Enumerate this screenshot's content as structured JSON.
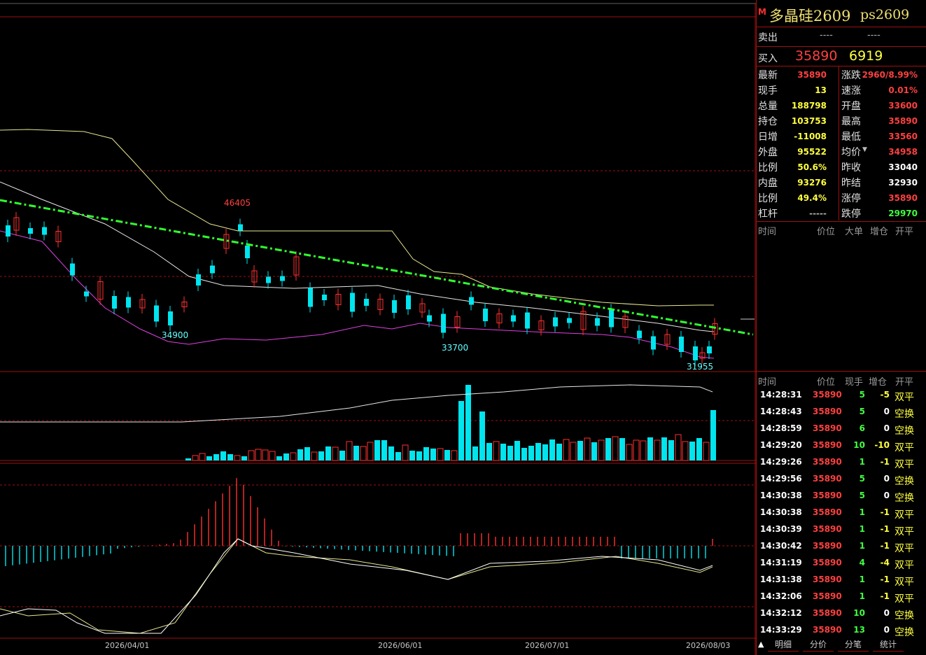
{
  "title": {
    "badge": "M",
    "name": "多晶硅2609",
    "code": "ps2609"
  },
  "sell": {
    "label": "卖出",
    "price": "----",
    "volume": "----"
  },
  "buy": {
    "label": "买入",
    "price": "35890",
    "volume": "6919"
  },
  "stats_left": [
    {
      "label": "最新",
      "value": "35890"
    },
    {
      "label": "现手",
      "value": "13"
    },
    {
      "label": "总量",
      "value": "188798"
    },
    {
      "label": "持仓",
      "value": "103753"
    },
    {
      "label": "日增",
      "value": "-11008"
    },
    {
      "label": "外盘",
      "value": "95522"
    },
    {
      "label": "比例",
      "value": "50.6%"
    },
    {
      "label": "内盘",
      "value": "93276"
    },
    {
      "label": "比例",
      "value": "49.4%"
    },
    {
      "label": "杠杆",
      "value": "-----"
    }
  ],
  "stats_right": [
    {
      "label": "涨跌",
      "value": "2960/8.99%"
    },
    {
      "label": "速涨",
      "value": "0.01%"
    },
    {
      "label": "开盘",
      "value": "33600"
    },
    {
      "label": "最高",
      "value": "35890"
    },
    {
      "label": "最低",
      "value": "33560"
    },
    {
      "label": "均价",
      "value": "34958"
    },
    {
      "label": "昨收",
      "value": "33040"
    },
    {
      "label": "昨结",
      "value": "32930"
    },
    {
      "label": "涨停",
      "value": "35890"
    },
    {
      "label": "跌停",
      "value": "29970"
    }
  ],
  "big_order_header": [
    "时间",
    "价位",
    "大单",
    "增仓",
    "开平"
  ],
  "ticks_header": [
    "时间",
    "价位",
    "现手",
    "增仓",
    "开平"
  ],
  "ticks": [
    {
      "time": "14:28:31",
      "price": "35890",
      "qty": "5",
      "chg": "-5",
      "type": "双平"
    },
    {
      "time": "14:28:43",
      "price": "35890",
      "qty": "5",
      "chg": "0",
      "type": "空换"
    },
    {
      "time": "14:28:59",
      "price": "35890",
      "qty": "6",
      "chg": "0",
      "type": "空换"
    },
    {
      "time": "14:29:20",
      "price": "35890",
      "qty": "10",
      "chg": "-10",
      "type": "双平"
    },
    {
      "time": "14:29:26",
      "price": "35890",
      "qty": "1",
      "chg": "-1",
      "type": "双平"
    },
    {
      "time": "14:29:56",
      "price": "35890",
      "qty": "5",
      "chg": "0",
      "type": "空换"
    },
    {
      "time": "14:30:38",
      "price": "35890",
      "qty": "5",
      "chg": "0",
      "type": "空换"
    },
    {
      "time": "14:30:38",
      "price": "35890",
      "qty": "1",
      "chg": "-1",
      "type": "双平"
    },
    {
      "time": "14:30:39",
      "price": "35890",
      "qty": "1",
      "chg": "-1",
      "type": "双平"
    },
    {
      "time": "14:30:42",
      "price": "35890",
      "qty": "1",
      "chg": "-1",
      "type": "双平"
    },
    {
      "time": "14:31:19",
      "price": "35890",
      "qty": "4",
      "chg": "-4",
      "type": "双平"
    },
    {
      "time": "14:31:38",
      "price": "35890",
      "qty": "1",
      "chg": "-1",
      "type": "双平"
    },
    {
      "time": "14:32:06",
      "price": "35890",
      "qty": "1",
      "chg": "-1",
      "type": "双平"
    },
    {
      "time": "14:32:12",
      "price": "35890",
      "qty": "10",
      "chg": "0",
      "type": "空换"
    },
    {
      "time": "14:33:29",
      "price": "35890",
      "qty": "13",
      "chg": "0",
      "type": "空换"
    }
  ],
  "tabs": [
    "明细",
    "分价",
    "分笔",
    "统计"
  ],
  "dates": [
    "2026/04/01",
    "2026/06/01",
    "2026/07/01",
    "2026/08/03"
  ],
  "kline_labels": {
    "high": "46405",
    "low1": "34900",
    "low2": "33700",
    "low3": "31955"
  },
  "chart_data": {
    "type": "candlestick",
    "candles": [
      {
        "o": 33200,
        "h": 46405,
        "l": 31955,
        "c": 35890
      }
    ],
    "annotations": [
      "46405",
      "34900",
      "33700",
      "31955"
    ],
    "colors": {
      "up": "#ff3030",
      "down": "#00e5ee",
      "trend": "#30ff30",
      "ma_up": "#e8e890",
      "ma_low": "#e040e0",
      "boll_mid": "#e8e8e8"
    }
  }
}
